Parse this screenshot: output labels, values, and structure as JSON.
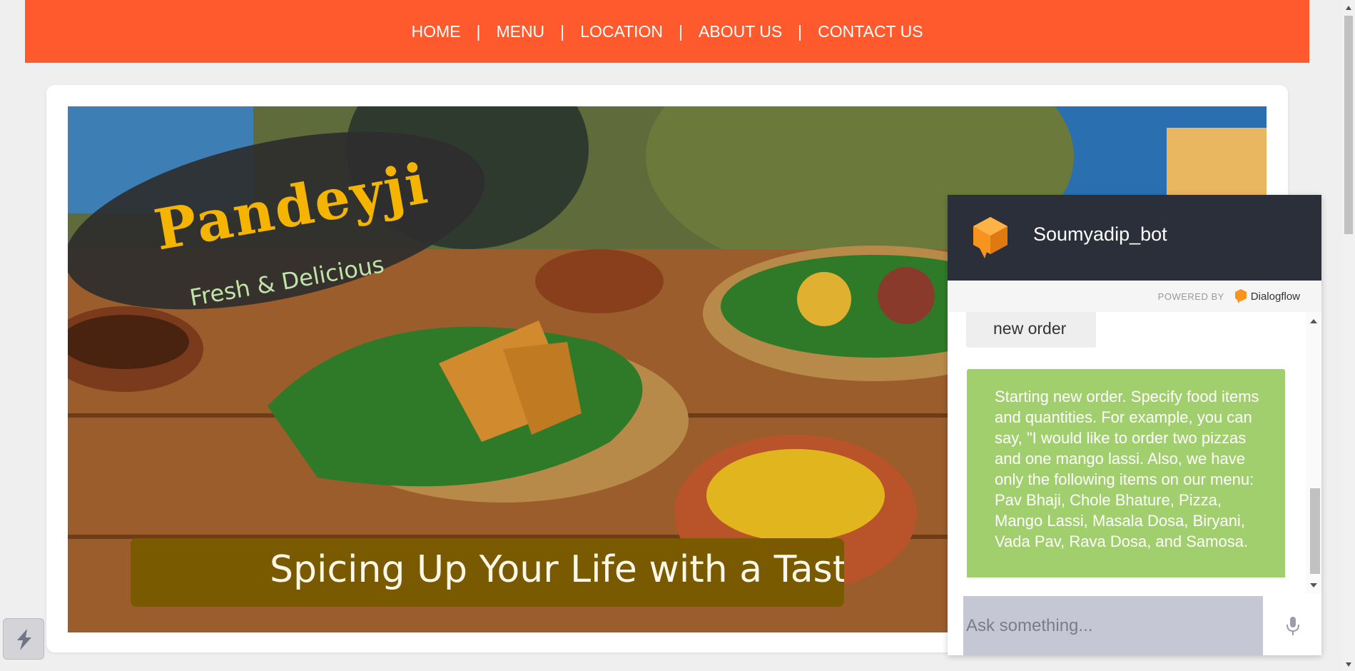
{
  "nav": {
    "bg": "#ff5a2e",
    "items": [
      {
        "label": "HOME"
      },
      {
        "label": "MENU"
      },
      {
        "label": "LOCATION"
      },
      {
        "label": "ABOUT US"
      },
      {
        "label": "CONTACT US"
      }
    ],
    "separator": "|"
  },
  "hero": {
    "logo_title": "Pandeyji",
    "logo_subtitle": "Fresh & Delicious",
    "banner_text": "Spicing Up Your Life with a Taste of"
  },
  "chat": {
    "title": "Soumyadip_bot",
    "powered_by_label": "POWERED BY",
    "powered_by_name": "Dialogflow",
    "user_message": "new order",
    "bot_message": "Starting new order. Specify food items and quantities. For example, you can say, \"I would like to order two pizzas and one mango lassi. Also, we have only the following items on our menu: Pav Bhaji, Chole Bhature, Pizza, Mango Lassi, Masala Dosa, Biryani, Vada Pav, Rava Dosa, and Samosa.",
    "input_placeholder": "Ask something...",
    "header_bg": "#2b2f3a",
    "bot_bubble_color": "#a2cf6d",
    "accent": "#f7941d"
  },
  "icons": {
    "chat_logo": "dialogflow-cube-icon",
    "mic": "microphone-icon",
    "floating": "lightning-icon"
  }
}
